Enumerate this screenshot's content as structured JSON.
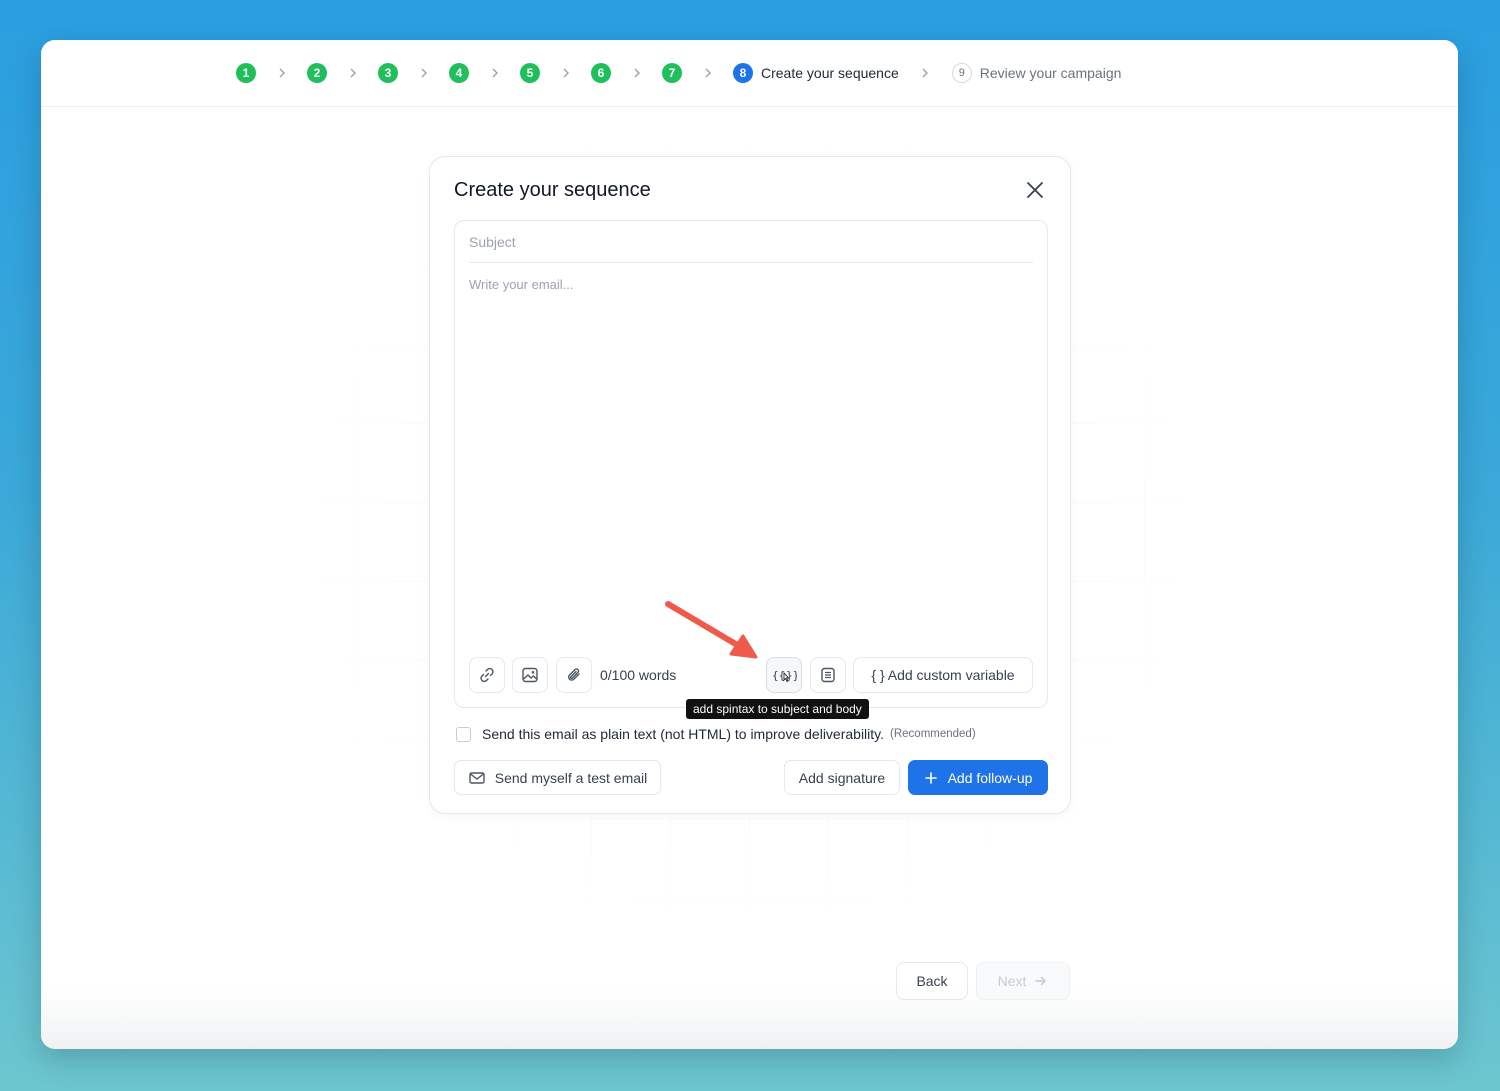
{
  "stepper": {
    "completed_steps": [
      "1",
      "2",
      "3",
      "4",
      "5",
      "6",
      "7"
    ],
    "active_step": {
      "number": "8",
      "label": "Create your sequence"
    },
    "next_step": {
      "number": "9",
      "label": "Review your campaign"
    }
  },
  "modal": {
    "title": "Create your sequence",
    "subject_placeholder": "Subject",
    "body_placeholder": "Write your email...",
    "word_count": "0/100 words",
    "custom_variable_label": "{ } Add custom variable",
    "tooltip": "add spintax to subject and body",
    "plaintext_label": "Send this email as plain text (not HTML) to improve deliverability.",
    "recommended_label": "(Recommended)",
    "test_email_label": "Send myself a test email",
    "add_signature_label": "Add signature",
    "add_followup_label": "Add follow-up"
  },
  "footer": {
    "back_label": "Back",
    "next_label": "Next"
  },
  "colors": {
    "completed": "#1fbf5c",
    "active": "#1f73e8",
    "primary_button": "#1f73e8",
    "annotation_arrow": "#f05a4a"
  },
  "icons": [
    "chevron-right-icon",
    "close-icon",
    "link-icon",
    "image-icon",
    "paperclip-icon",
    "spintax-icon",
    "template-icon",
    "mail-icon",
    "plus-icon",
    "arrow-right-icon"
  ]
}
